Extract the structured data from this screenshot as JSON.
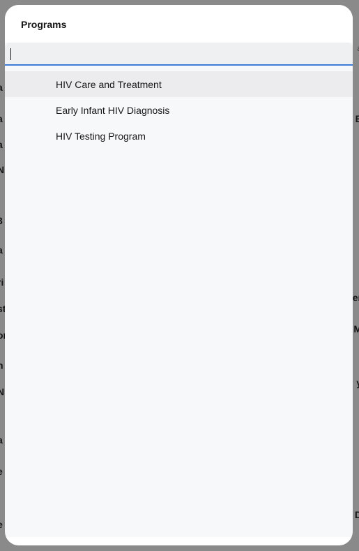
{
  "background": {
    "left_fragments": [
      "a",
      "a",
      "a",
      "N",
      "3",
      "a",
      "ri",
      "st",
      "or",
      "n",
      "N",
      "a",
      "e",
      "e"
    ],
    "right_fragments": [
      "a",
      "E",
      "er",
      "M",
      "y",
      "D"
    ]
  },
  "modal": {
    "title": "Programs",
    "search": {
      "value": "",
      "placeholder": ""
    },
    "items": [
      {
        "label": "HIV Care and Treatment"
      },
      {
        "label": "Early Infant HIV Diagnosis"
      },
      {
        "label": "HIV Testing Program"
      }
    ]
  },
  "colors": {
    "accent": "#3d7bd9",
    "overlay": "rgba(22,22,22,0.5)",
    "modal_bg": "#f7f8f9",
    "highlight": "#ececee"
  }
}
